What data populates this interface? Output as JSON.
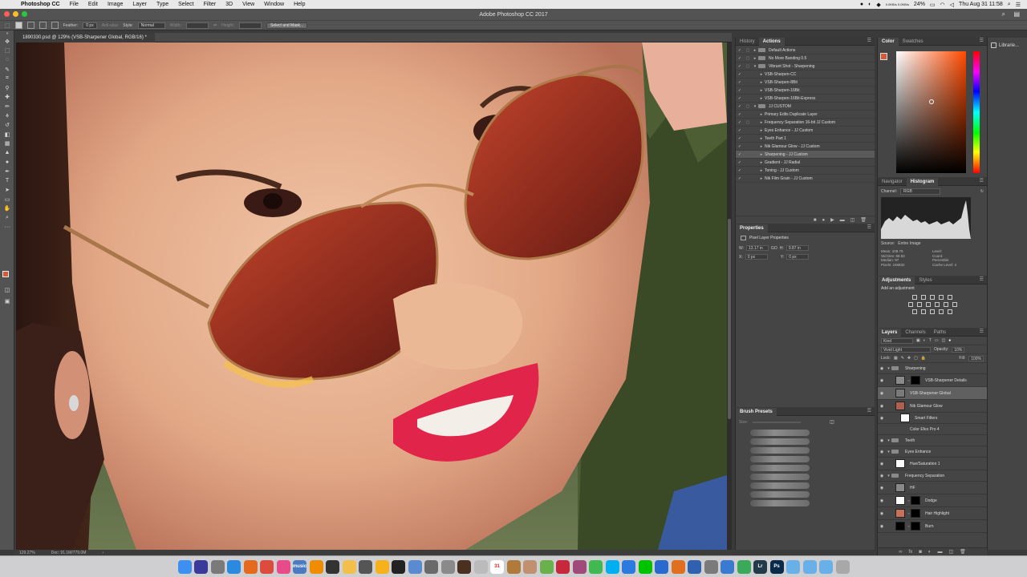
{
  "menubar": {
    "apple": "",
    "app_name": "Photoshop CC",
    "items": [
      "File",
      "Edit",
      "Image",
      "Layer",
      "Type",
      "Select",
      "Filter",
      "3D",
      "View",
      "Window",
      "Help"
    ],
    "cpu_readout": "0.0KB/s 0.0KB/s",
    "battery": "24%",
    "clock": "Thu Aug 31 11:58"
  },
  "window": {
    "title": "Adobe Photoshop CC 2017"
  },
  "options_bar": {
    "feather_label": "Feather:",
    "feather_value": "0 px",
    "anti_alias": "Anti-alias",
    "style_label": "Style:",
    "style_value": "Normal",
    "width_label": "Width:",
    "height_label": "Height:",
    "select_mask_button": "Select and Mask..."
  },
  "document": {
    "tab_title": "1890330.psd @ 129% (VSB-Sharpener Global, RGB/16) *",
    "zoom": "129.27%",
    "doc_size": "Doc: 91.1M/779.0M"
  },
  "actions_panel": {
    "tabs": [
      "History",
      "Actions"
    ],
    "active_tab": "Actions",
    "rows": [
      {
        "label": "Default Actions",
        "folder": true,
        "level": 0,
        "expanded": false
      },
      {
        "label": "No More Banding 0.5",
        "folder": true,
        "level": 0,
        "expanded": false
      },
      {
        "label": "Vibrant Shot - Sharpening",
        "folder": true,
        "level": 0,
        "expanded": true
      },
      {
        "label": "VSB-Sharpen-CC",
        "folder": false,
        "level": 1
      },
      {
        "label": "VSB-Sharpen-8Bit",
        "folder": false,
        "level": 1
      },
      {
        "label": "VSB-Sharpen-16Bit",
        "folder": false,
        "level": 1
      },
      {
        "label": "VSB-Sharpen-16Bit-Express",
        "folder": false,
        "level": 1
      },
      {
        "label": "JJ CUSTOM",
        "folder": true,
        "level": 0,
        "expanded": true
      },
      {
        "label": "Primary Edits Duplicate Layer",
        "folder": false,
        "level": 1
      },
      {
        "label": "Frequency Separation 16-bit JJ Custom",
        "folder": false,
        "level": 1
      },
      {
        "label": "Eyes Enhance - JJ Custom",
        "folder": false,
        "level": 1
      },
      {
        "label": "Teeth Part 1",
        "folder": false,
        "level": 1
      },
      {
        "label": "Nik Glamour Glow - JJ Custom",
        "folder": false,
        "level": 1
      },
      {
        "label": "Sharpening - JJ Custom",
        "folder": false,
        "level": 1,
        "selected": true
      },
      {
        "label": "Gradient - JJ Radial",
        "folder": false,
        "level": 1
      },
      {
        "label": "Toning - JJ Custom",
        "folder": false,
        "level": 1
      },
      {
        "label": "Nik Film Grain - JJ Custom",
        "folder": false,
        "level": 1
      }
    ]
  },
  "properties_panel": {
    "tab": "Properties",
    "title": "Pixel Layer Properties",
    "w_label": "W:",
    "w_value": "13.17 in",
    "h_label": "H:",
    "h_value": "9.87 in",
    "x_label": "X:",
    "x_value": "0 px",
    "y_label": "Y:",
    "y_value": "0 px",
    "link_glyph": "GO"
  },
  "brush_presets": {
    "tab": "Brush Presets",
    "size_label": "Size:"
  },
  "color_panel": {
    "tabs": [
      "Color",
      "Swatches"
    ],
    "active_tab": "Color",
    "fg_color": "#d35b3a"
  },
  "histogram_panel": {
    "tabs": [
      "Navigator",
      "Histogram"
    ],
    "active_tab": "Histogram",
    "channel_label": "Channel:",
    "channel_value": "RGB",
    "source_label": "Source:",
    "source_value": "Entire Image",
    "stats_left": [
      "Mean: 108.79",
      "Std Dev: 68.82",
      "Median: 97",
      "Pixels: 246832"
    ],
    "stats_right": [
      "Level:",
      "Count:",
      "Percentile:",
      "Cache Level: 4"
    ]
  },
  "adjustments_panel": {
    "tabs": [
      "Adjustments",
      "Styles"
    ],
    "active_tab": "Adjustments",
    "add_label": "Add an adjustment"
  },
  "layers_panel": {
    "tabs": [
      "Layers",
      "Channels",
      "Paths"
    ],
    "active_tab": "Layers",
    "kind_filter": "Kind",
    "blend_mode": "Vivid Light",
    "opacity_label": "Opacity:",
    "opacity_value": "10%",
    "lock_label": "Lock:",
    "fill_label": "Fill:",
    "fill_value": "100%",
    "rows": [
      {
        "label": "Sharpening",
        "type": "group"
      },
      {
        "label": "VSB-Sharpener Details",
        "type": "layer",
        "thumb": "#8a8a8a",
        "mask": "#000"
      },
      {
        "label": "VSB-Sharpener Global",
        "type": "layer",
        "thumb": "#7a7a7a",
        "selected": true
      },
      {
        "label": "Nik Glamour Glow",
        "type": "layer",
        "thumb": "#b06050"
      },
      {
        "label": "Smart Filters",
        "type": "sub",
        "thumb": "#ffffff"
      },
      {
        "label": "Color Efex Pro 4",
        "type": "subitem"
      },
      {
        "label": "Teeth",
        "type": "group"
      },
      {
        "label": "Eyes Enhance",
        "type": "group"
      },
      {
        "label": "Hue/Saturation 1",
        "type": "layer",
        "thumb": "#ffffff"
      },
      {
        "label": "Frequency Separation",
        "type": "group"
      },
      {
        "label": "HF",
        "type": "layer",
        "thumb": "#888888"
      },
      {
        "label": "Dodge",
        "type": "layer",
        "thumb": "#ffffff",
        "mask": "#000"
      },
      {
        "label": "Hair Highlight",
        "type": "layer",
        "thumb": "#c8705a",
        "mask": "#000"
      },
      {
        "label": "Burn",
        "type": "layer",
        "thumb": "#000000",
        "mask": "#000"
      }
    ]
  },
  "libraries": {
    "label": "Librarie..."
  },
  "dock": {
    "apps": [
      {
        "name": "finder",
        "color": "#3d8ff0",
        "label": ""
      },
      {
        "name": "siri",
        "color": "#3a3a9a",
        "label": ""
      },
      {
        "name": "launchpad",
        "color": "#7a7a7a",
        "label": ""
      },
      {
        "name": "safari",
        "color": "#2a8ae0",
        "label": ""
      },
      {
        "name": "firefox",
        "color": "#e66a1e",
        "label": ""
      },
      {
        "name": "chrome",
        "color": "#dd4b3e",
        "label": ""
      },
      {
        "name": "itunes",
        "color": "#e94b8a",
        "label": ""
      },
      {
        "name": "music",
        "color": "#4a7ac0",
        "label": "music"
      },
      {
        "name": "vlc",
        "color": "#f08c00",
        "label": ""
      },
      {
        "name": "final-cut",
        "color": "#333333",
        "label": ""
      },
      {
        "name": "photos",
        "color": "#f2c04a",
        "label": ""
      },
      {
        "name": "motion",
        "color": "#555555",
        "label": ""
      },
      {
        "name": "sketch",
        "color": "#f7b21b",
        "label": ""
      },
      {
        "name": "unity",
        "color": "#222222",
        "label": ""
      },
      {
        "name": "preview",
        "color": "#5a8ad0",
        "label": ""
      },
      {
        "name": "screenshot",
        "color": "#6a6a6a",
        "label": ""
      },
      {
        "name": "system-prefs",
        "color": "#8a8a8a",
        "label": ""
      },
      {
        "name": "adobe-app",
        "color": "#4a3020",
        "label": ""
      },
      {
        "name": "alien",
        "color": "#bbbbbb",
        "label": ""
      },
      {
        "name": "calendar",
        "color": "#ffffff",
        "label": "31"
      },
      {
        "name": "books",
        "color": "#b07a3a",
        "label": ""
      },
      {
        "name": "contacts",
        "color": "#c09070",
        "label": ""
      },
      {
        "name": "maps",
        "color": "#6ab04c",
        "label": ""
      },
      {
        "name": "acrobat",
        "color": "#c8283c",
        "label": ""
      },
      {
        "name": "affinity",
        "color": "#a04a7a",
        "label": ""
      },
      {
        "name": "messages",
        "color": "#3fb950",
        "label": ""
      },
      {
        "name": "skype",
        "color": "#00aff0",
        "label": ""
      },
      {
        "name": "app-store",
        "color": "#2a7ae0",
        "label": ""
      },
      {
        "name": "line",
        "color": "#00c300",
        "label": ""
      },
      {
        "name": "vpn",
        "color": "#2a6ad0",
        "label": ""
      },
      {
        "name": "vectorize",
        "color": "#e07020",
        "label": ""
      },
      {
        "name": "transmit",
        "color": "#3060b0",
        "label": ""
      },
      {
        "name": "disk-utility",
        "color": "#7a7a7a",
        "label": ""
      },
      {
        "name": "keynote",
        "color": "#3a7ad0",
        "label": ""
      },
      {
        "name": "network",
        "color": "#3aaa5a",
        "label": ""
      },
      {
        "name": "lightroom",
        "color": "#233a4a",
        "label": "Lr"
      },
      {
        "name": "photoshop",
        "color": "#0a2a4a",
        "label": "Ps"
      },
      {
        "name": "folder-1",
        "color": "#6ab0e8",
        "label": ""
      },
      {
        "name": "folder-2",
        "color": "#6ab0e8",
        "label": ""
      },
      {
        "name": "folder-3",
        "color": "#6ab0e8",
        "label": ""
      },
      {
        "name": "trash",
        "color": "#a8a8a8",
        "label": ""
      }
    ]
  }
}
